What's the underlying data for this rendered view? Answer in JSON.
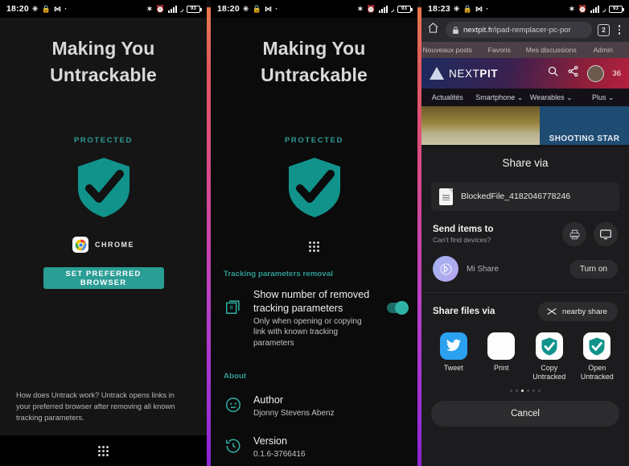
{
  "panel1": {
    "status": {
      "time": "18:20",
      "icons_left": [
        "nfc-icon",
        "lock-icon",
        "dnd-icon",
        "dot-icon"
      ],
      "icons_right": [
        "bluetooth-icon",
        "alarm-icon",
        "signal-icon",
        "wifi-icon",
        "battery-icon"
      ],
      "battery_level": "93"
    },
    "title_line1": "Making You",
    "title_line2": "Untrackable",
    "protected_label": "PROTECTED",
    "browser_name": "CHROME",
    "set_browser_button": "SET PREFERRED BROWSER",
    "footnote": "How does Untrack work? Untrack opens links in your preferred browser after removing all known tracking parameters."
  },
  "panel2": {
    "status": {
      "time": "18:20",
      "battery_level": "93"
    },
    "title_line1": "Making You",
    "title_line2": "Untrackable",
    "protected_label": "PROTECTED",
    "section_tracking": "Tracking parameters removal",
    "setting": {
      "title": "Show number of removed tracking parameters",
      "subtitle": "Only when opening or copying link with known tracking parameters",
      "toggle_state": "on",
      "icon": "counter-badge-icon"
    },
    "section_about": "About",
    "about_rows": [
      {
        "icon": "person-circle-icon",
        "title": "Author",
        "value": "Djonny Stevens Abenz"
      },
      {
        "icon": "history-clock-icon",
        "title": "Version",
        "value": "0.1.6-3766416"
      }
    ]
  },
  "panel3": {
    "status": {
      "time": "18:23",
      "battery_level": "93"
    },
    "omnibar": {
      "url_domain": "nextpit.fr",
      "url_path": "/ipad-remplacer-pc-por",
      "tab_count": "2",
      "lock_icon": "lock-icon",
      "home_icon": "home-icon",
      "menu_icon": "kebab-menu-icon"
    },
    "site_tabs": [
      "Nouveaux posts",
      "Favoris",
      "Mes discussions",
      "Admin"
    ],
    "site_logo": {
      "first": "NEXT",
      "second": "PIT"
    },
    "site_header_icons": [
      "search-icon",
      "share-icon",
      "avatar"
    ],
    "notification_count": "36",
    "site_nav": [
      "Actualités",
      "Smartphone ⌄",
      "Wearables ⌄",
      "Plus ⌄"
    ],
    "ad_text": "SHOOTING STAR",
    "share_sheet": {
      "title": "Share via",
      "file_name": "BlockedFile_4182046778246",
      "send_items_title": "Send items to",
      "send_items_sub": "Can't find devices?",
      "send_icons": [
        "printer-icon",
        "display-icon"
      ],
      "mi_share_name": "Mi Share",
      "turn_on_button": "Turn on",
      "share_files_title": "Share files via",
      "nearby_button": "nearby share",
      "apps": [
        {
          "name": "Tweet",
          "icon": "twitter-icon"
        },
        {
          "name": "Print",
          "icon": "print-icon"
        },
        {
          "name": "Copy Untracked",
          "icon": "shield-check-icon"
        },
        {
          "name": "Open Untracked",
          "icon": "shield-check-icon"
        }
      ],
      "pager_total": 6,
      "pager_active": 3,
      "cancel_button": "Cancel"
    }
  },
  "colors": {
    "teal": "#2a9d94",
    "teal_light": "#2fb3a6",
    "accent_gradient_top": "#e8784e",
    "accent_gradient_bottom": "#8a23d0"
  }
}
